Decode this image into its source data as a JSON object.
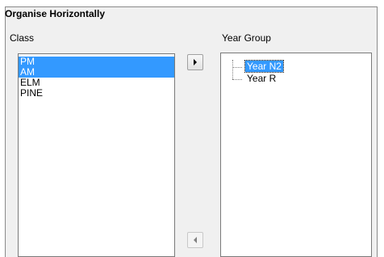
{
  "title": "Organise Horizontally",
  "class_list": {
    "label": "Class",
    "items": [
      {
        "label": "PM",
        "selected": true
      },
      {
        "label": "AM",
        "selected": true
      },
      {
        "label": "ELM",
        "selected": false
      },
      {
        "label": "PINE",
        "selected": false
      }
    ]
  },
  "year_group": {
    "label": "Year Group",
    "items": [
      {
        "label": "Year N2",
        "selected": true
      },
      {
        "label": "Year R",
        "selected": false
      }
    ]
  },
  "buttons": {
    "move_right_icon": "triangle-right",
    "move_left_icon": "triangle-left"
  },
  "colors": {
    "selection": "#3399ff",
    "panel": "#f0f0f0"
  }
}
